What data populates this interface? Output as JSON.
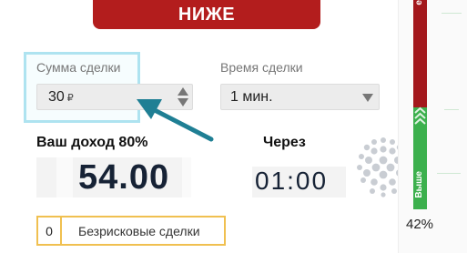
{
  "trade": {
    "lower_label": "НИЖЕ"
  },
  "amount": {
    "label": "Сумма сделки",
    "value": "30",
    "currency": "₽"
  },
  "time": {
    "label": "Время сделки",
    "value": "1 мин."
  },
  "income": {
    "label": "Ваш доход 80%",
    "value": "54.00"
  },
  "timer": {
    "label": "Через",
    "value": "01:00"
  },
  "riskfree": {
    "count": "0",
    "label": "Безрисковые сделки"
  },
  "sentiment": {
    "lower_text": "е",
    "higher_text": "Выше",
    "higher_percent_label": "42%",
    "higher_percent": 42
  },
  "colors": {
    "lower": "#b31d1d",
    "higher": "#3cb04d",
    "highlight": "#aee3f0",
    "arrow": "#1f7f94",
    "riskfree_border": "#f0c050"
  },
  "icons": {
    "annotation": "arrow-annotation-icon",
    "globe": "globe-icon",
    "stepper": "stepper-icon",
    "caret": "chevron-down-icon"
  }
}
